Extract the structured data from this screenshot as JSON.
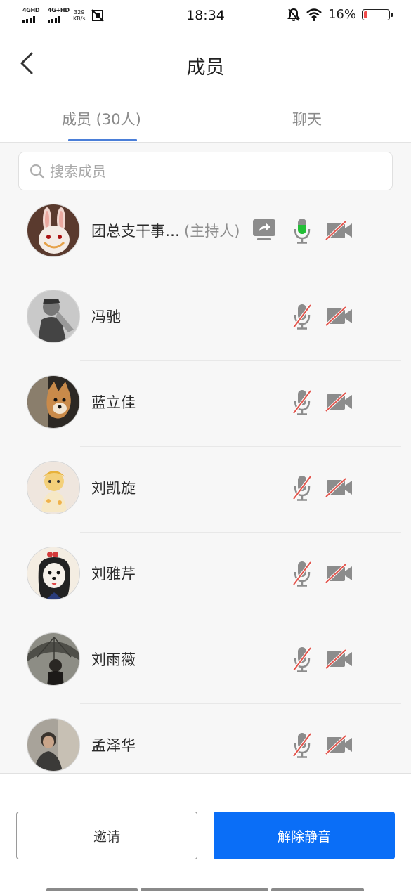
{
  "status_bar": {
    "signal_1": "4GHD",
    "signal_2": "4G+HD",
    "net_speed_value": "329",
    "net_speed_unit": "KB/s",
    "time": "18:34",
    "battery_text": "16%",
    "battery_level": 0.16,
    "battery_color": "#ef4b4b",
    "icons": [
      "network-signal-icon",
      "screenshot-app-icon",
      "mute-bell-icon",
      "wifi-icon",
      "battery-icon"
    ]
  },
  "header": {
    "title": "成员",
    "back_icon": "chevron-left-icon"
  },
  "tabs": [
    {
      "label": "成员 (30人)",
      "active": true
    },
    {
      "label": "聊天",
      "active": false
    }
  ],
  "search": {
    "placeholder": "搜索成员",
    "value": ""
  },
  "members": [
    {
      "name": "团总支干事…",
      "role": "(主持人)",
      "avatar": "rabbit",
      "sharing": true,
      "mic_on": true,
      "camera_on": false
    },
    {
      "name": "冯驰",
      "role": "",
      "avatar": "sketch",
      "sharing": false,
      "mic_on": false,
      "camera_on": false
    },
    {
      "name": "蓝立佳",
      "role": "",
      "avatar": "shiba",
      "sharing": false,
      "mic_on": false,
      "camera_on": false
    },
    {
      "name": "刘凯旋",
      "role": "",
      "avatar": "doll",
      "sharing": false,
      "mic_on": false,
      "camera_on": false
    },
    {
      "name": "刘雅芹",
      "role": "",
      "avatar": "cartoon-dog",
      "sharing": false,
      "mic_on": false,
      "camera_on": false
    },
    {
      "name": "刘雨薇",
      "role": "",
      "avatar": "umbrella",
      "sharing": false,
      "mic_on": false,
      "camera_on": false
    },
    {
      "name": "孟泽华",
      "role": "",
      "avatar": "person",
      "sharing": false,
      "mic_on": false,
      "camera_on": false
    }
  ],
  "actions": {
    "invite_label": "邀请",
    "unmute_label": "解除静音"
  },
  "colors": {
    "accent": "#0a6ef7",
    "tab_underline": "#4a7ed8",
    "mic_active": "#22c036",
    "muted_slash": "#e2554d",
    "icon_gray": "#8c8c8c"
  }
}
